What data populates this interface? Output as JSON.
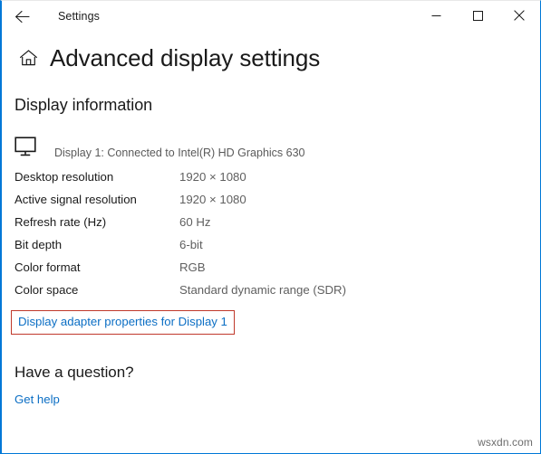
{
  "window": {
    "title": "Settings",
    "back_icon": "back-arrow-icon",
    "controls": {
      "minimize": "minimize-icon",
      "maximize": "maximize-icon",
      "close": "close-icon"
    },
    "accent_color": "#0078d7"
  },
  "header": {
    "home_icon": "home-icon",
    "title": "Advanced display settings"
  },
  "section": {
    "heading": "Display information",
    "monitor_icon": "monitor-icon",
    "monitor_caption": "Display 1: Connected to Intel(R) HD Graphics 630"
  },
  "info_rows": [
    {
      "label": "Desktop resolution",
      "value": "1920 × 1080"
    },
    {
      "label": "Active signal resolution",
      "value": "1920 × 1080"
    },
    {
      "label": "Refresh rate (Hz)",
      "value": "60 Hz"
    },
    {
      "label": "Bit depth",
      "value": "6-bit"
    },
    {
      "label": "Color format",
      "value": "RGB"
    },
    {
      "label": "Color space",
      "value": "Standard dynamic range (SDR)"
    }
  ],
  "adapter_link": {
    "label": "Display adapter properties for Display 1",
    "highlight_color": "#c0392b",
    "link_color": "#0b6ec4"
  },
  "footer": {
    "question_heading": "Have a question?",
    "get_help_label": "Get help"
  },
  "watermark": "wsxdn.com"
}
